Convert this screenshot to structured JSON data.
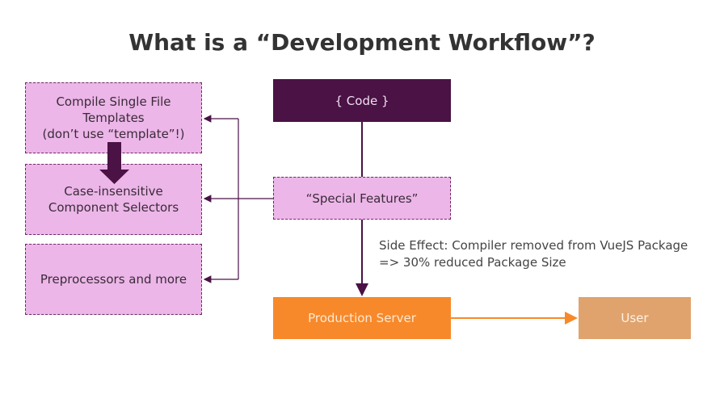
{
  "title": "What is a “Development Workflow”?",
  "left_boxes": [
    {
      "lines": [
        "Compile Single File",
        "Templates",
        "(don’t use “template”!)"
      ]
    },
    {
      "lines": [
        "Case-insensitive",
        "Component Selectors"
      ]
    },
    {
      "lines": [
        "Preprocessors and more"
      ]
    }
  ],
  "code_label": "{ Code }",
  "special_label": "“Special Features”",
  "side_effect": [
    "Side Effect: Compiler removed from VueJS Package",
    "=> 30% reduced Package Size"
  ],
  "prod_label": "Production Server",
  "user_label": "User",
  "colors": {
    "code_bg": "#4a1245",
    "pink_bg": "#ecb6e8",
    "prod_bg": "#f7892a",
    "user_bg": "#e0a36d",
    "connector": "#4a1245"
  }
}
